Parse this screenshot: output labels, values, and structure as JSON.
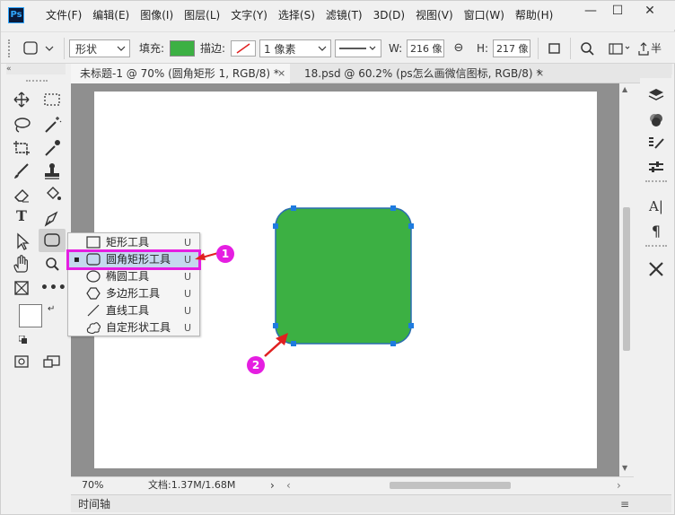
{
  "app": {
    "logo": "Ps"
  },
  "menu": [
    "文件(F)",
    "编辑(E)",
    "图像(I)",
    "图层(L)",
    "文字(Y)",
    "选择(S)",
    "滤镜(T)",
    "3D(D)",
    "视图(V)",
    "窗口(W)",
    "帮助(H)"
  ],
  "window_controls": {
    "minimize": "—",
    "maximize": "☐",
    "close": "✕"
  },
  "options": {
    "mode_value": "形状",
    "fill_label": "填充:",
    "fill_color": "#3cb043",
    "stroke_label": "描边:",
    "stroke_width": "1 像素",
    "w_label": "W:",
    "w_value": "216 像",
    "link_icon": "⊖",
    "h_label": "H:",
    "h_value": "217 像",
    "extra_label": "半"
  },
  "tabs": [
    {
      "label": "未标题-1 @ 70% (圆角矩形 1, RGB/8) *",
      "close": "×"
    },
    {
      "label": "18.psd @ 60.2% (ps怎么画微信图标, RGB/8) *",
      "close": "×"
    }
  ],
  "shape": {
    "fill": "#3cb043",
    "stroke": "#2a6db0",
    "handle_color": "#1e7be0"
  },
  "flyout": {
    "items": [
      {
        "icon": "rectangle-icon",
        "label": "矩形工具",
        "key": "U",
        "selected": false
      },
      {
        "icon": "rounded-rectangle-icon",
        "label": "圆角矩形工具",
        "key": "U",
        "selected": true
      },
      {
        "icon": "ellipse-icon",
        "label": "椭圆工具",
        "key": "U",
        "selected": false
      },
      {
        "icon": "polygon-icon",
        "label": "多边形工具",
        "key": "U",
        "selected": false
      },
      {
        "icon": "line-icon",
        "label": "直线工具",
        "key": "U",
        "selected": false
      },
      {
        "icon": "custom-shape-icon",
        "label": "自定形状工具",
        "key": "U",
        "selected": false
      }
    ]
  },
  "callouts": {
    "one": "1",
    "two": "2",
    "color": "#e51ee1"
  },
  "status": {
    "zoom": "70%",
    "doc_info": "文档:1.37M/1.68M"
  },
  "timeline": {
    "label": "时间轴"
  }
}
